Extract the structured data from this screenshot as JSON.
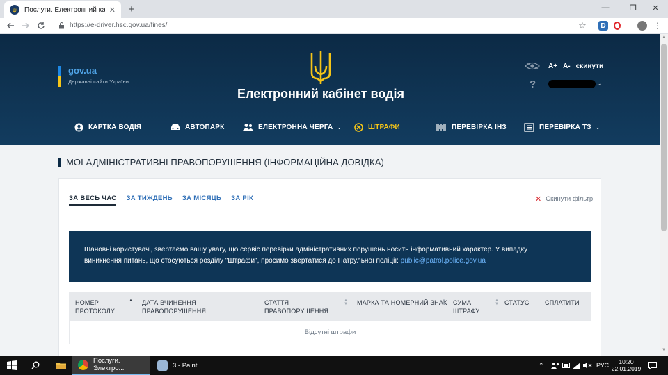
{
  "browser": {
    "tab_title": "Послуги. Електронний кабінет в",
    "new_tab": "+",
    "url": "https://e-driver.hsc.gov.ua/fines/",
    "min": "—",
    "restore": "❐",
    "close": "✕"
  },
  "header": {
    "govua_name": "gov.ua",
    "govua_sub": "Державні сайти України",
    "site_title": "Електронний кабінет водія",
    "font_plus": "A+",
    "font_minus": "A-",
    "reset": "скинути",
    "help": "?"
  },
  "nav": [
    {
      "label": "КАРТКА ВОДІЯ",
      "icon": "driver-card-icon"
    },
    {
      "label": "АВТОПАРК",
      "icon": "car-icon"
    },
    {
      "label": "ЕЛЕКТРОННА ЧЕРГА",
      "icon": "queue-icon"
    },
    {
      "label": "ШТРАФИ",
      "icon": "fines-icon"
    },
    {
      "label": "ПЕРЕВІРКА ІНЗ",
      "icon": "barcode-icon"
    },
    {
      "label": "ПЕРЕВІРКА ТЗ",
      "icon": "document-icon"
    }
  ],
  "page": {
    "heading": "МОЇ АДМІНІСТРАТИВНІ ПРАВОПОРУШЕННЯ (ІНФОРМАЦІЙНА ДОВІДКА)",
    "filters": [
      "ЗА ВЕСЬ ЧАС",
      "ЗА ТИЖДЕНЬ",
      "ЗА МІСЯЦЬ",
      "ЗА РІК"
    ],
    "active_filter": "ЗА ВЕСЬ ЧАС",
    "reset_filter": "Скинути фільтр",
    "notice_line1": "Шановні користувачі, звертаємо вашу увагу, що сервіс перевірки адміністративних порушень носить інформативний характер. У випадку",
    "notice_line2": "виникнення питань, що стосуються розділу \"Штрафи\", просимо звертатися до Патрульної поліції:",
    "notice_email": "public@patrol.police.gov.ua",
    "columns": [
      "НОМЕР ПРОТОКОЛУ",
      "ДАТА ВЧИНЕННЯ ПРАВОПОРУШЕННЯ",
      "СТАТТЯ ПРАВОПОРУШЕННЯ",
      "МАРКА ТА НОМЕРНИЙ ЗНАК",
      "СУМА ШТРАФУ",
      "СТАТУС",
      "СПЛАТИТИ"
    ],
    "empty": "Відсутні штрафи"
  },
  "taskbar": {
    "chrome_app": "Послуги. Электро...",
    "paint_app": "3 - Paint",
    "lang": "РУС",
    "time": "10:20",
    "date": "22.01.2019"
  },
  "colors": {
    "header_bg": "#0c2a45",
    "accent_yellow": "#f5c518",
    "link_blue": "#2f6fb7",
    "notice_bg": "#0e3556"
  }
}
